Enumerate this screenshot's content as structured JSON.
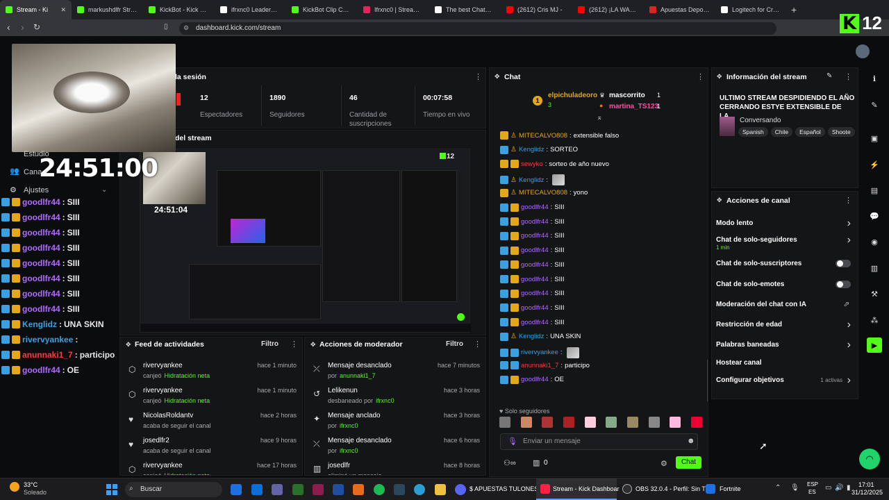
{
  "tabs": [
    {
      "label": "Stream - Ki",
      "color": "#53fc18",
      "active": true
    },
    {
      "label": "markushdlfr Stream",
      "color": "#53fc18"
    },
    {
      "label": "KickBot - Kick Chat",
      "color": "#53fc18"
    },
    {
      "label": "ifrxnc0 LeaderBoar",
      "color": "#ffffff"
    },
    {
      "label": "KickBot Clip Comm",
      "color": "#53fc18"
    },
    {
      "label": "Ifrxnc0 | Streamloot",
      "color": "#e0245e"
    },
    {
      "label": "The best ChatBot ai",
      "color": "#ffffff"
    },
    {
      "label": "(2612) Cris MJ -",
      "color": "#ff0000"
    },
    {
      "label": "(2612) ¡LA WANTED",
      "color": "#ff0000"
    },
    {
      "label": "Apuestas Deportiv",
      "color": "#d22"
    },
    {
      "label": "Logitech for Creato",
      "color": "#fff"
    }
  ],
  "address": "dashboard.kick.com/stream",
  "kick_badge": {
    "letter": "K",
    "viewers": "12"
  },
  "overlay": {
    "timer": "24:51:00",
    "sidebar_items": [
      "Estudio",
      "Cana",
      "Ajustes"
    ],
    "chat": [
      {
        "user": "goodlfr44",
        "msg": "SIII",
        "color": "#b06cff"
      },
      {
        "user": "goodlfr44",
        "msg": "SIII",
        "color": "#b06cff"
      },
      {
        "user": "goodlfr44",
        "msg": "SIII",
        "color": "#b06cff"
      },
      {
        "user": "goodlfr44",
        "msg": "SIII",
        "color": "#b06cff"
      },
      {
        "user": "goodlfr44",
        "msg": "SIII",
        "color": "#b06cff"
      },
      {
        "user": "goodlfr44",
        "msg": "SIII",
        "color": "#b06cff"
      },
      {
        "user": "goodlfr44",
        "msg": "SIII",
        "color": "#b06cff"
      },
      {
        "user": "goodlfr44",
        "msg": "SIII",
        "color": "#b06cff"
      },
      {
        "user": "Kenglidz",
        "msg": "UNA SKIN",
        "color": "#3aa0e0"
      },
      {
        "user": "rivervyankee",
        "msg": "",
        "color": "#3aa0e0"
      },
      {
        "user": "anunnaki1_7",
        "msg": "participo",
        "color": "#ff3a3a"
      },
      {
        "user": "goodlfr44",
        "msg": "OE",
        "color": "#b06cff"
      }
    ]
  },
  "session": {
    "title": "la sesión",
    "stats": [
      {
        "value": "12",
        "label": "Espectadores"
      },
      {
        "value": "1890",
        "label": "Seguidores"
      },
      {
        "value": "46",
        "label": "Cantidad de suscripciones"
      },
      {
        "value": "00:07:58",
        "label": "Tiempo en vivo"
      }
    ]
  },
  "preview": {
    "title": "del stream",
    "mini_timer": "24:51:04",
    "mini_count": "12"
  },
  "activity": {
    "title": "Feed de actividades",
    "filter": "Filtro",
    "items": [
      {
        "user": "rivervyankee",
        "time": "hace 1 minuto",
        "action": "canjeó",
        "detail": "Hidratación neta"
      },
      {
        "user": "rivervyankee",
        "time": "hace 1 minuto",
        "action": "canjeó",
        "detail": "Hidratación neta"
      },
      {
        "user": "NicolasRoldantv",
        "time": "hace 2 horas",
        "action": "acaba de seguir el canal",
        "detail": ""
      },
      {
        "user": "josedlfr2",
        "time": "hace 9 horas",
        "action": "acaba de seguir el canal",
        "detail": ""
      },
      {
        "user": "rivervyankee",
        "time": "hace 17 horas",
        "action": "canjeó",
        "detail": "Hidratación neta"
      }
    ]
  },
  "modactions": {
    "title": "Acciones de moderador",
    "filter": "Filtro",
    "items": [
      {
        "title": "Mensaje desanclado",
        "time": "hace 7 minutos",
        "by": "por",
        "who": "anunnaki1_7"
      },
      {
        "title": "Lelikenun",
        "time": "hace 3 horas",
        "by": "desbaneado por",
        "who": "ifrxnc0"
      },
      {
        "title": "Mensaje anclado",
        "time": "hace 3 horas",
        "by": "por",
        "who": "ifrxnc0"
      },
      {
        "title": "Mensaje desanclado",
        "time": "hace 6 horas",
        "by": "por",
        "who": "ifrxnc0"
      },
      {
        "title": "josedlfr",
        "time": "hace 8 horas",
        "by": "eliminó un mensaje",
        "who": ""
      }
    ]
  },
  "chat": {
    "title": "Chat",
    "pinned": {
      "rank": "1",
      "name1": "elpichuladeoro",
      "count1": "3",
      "name2": "mascorrito",
      "count2": "1",
      "name3": "martina_TS123",
      "count3": "1"
    },
    "messages": [
      {
        "user": "MITECALVO808",
        "msg": "extensible falso",
        "color": "#e2a71a",
        "badges": [
          "gold",
          "none"
        ]
      },
      {
        "user": "Kenglidz",
        "msg": "SORTEO",
        "color": "#3aa0e0",
        "badges": [
          "blue",
          "none"
        ]
      },
      {
        "user": "sewyko",
        "msg": "sorteo de año nuevo",
        "color": "#ff3a3a",
        "badges": [
          "gold",
          "gold"
        ]
      },
      {
        "user": "Kenglidz",
        "msg": "",
        "color": "#3aa0e0",
        "badges": [
          "blue",
          "none"
        ]
      },
      {
        "user": "MITECALVO808",
        "msg": "yono",
        "color": "#e2a71a",
        "badges": [
          "gold",
          "none"
        ]
      },
      {
        "user": "goodlfr44",
        "msg": "SIII",
        "color": "#b06cff",
        "badges": [
          "blue",
          "gold"
        ]
      },
      {
        "user": "goodlfr44",
        "msg": "SIII",
        "color": "#b06cff",
        "badges": [
          "blue",
          "gold"
        ]
      },
      {
        "user": "goodlfr44",
        "msg": "SIII",
        "color": "#b06cff",
        "badges": [
          "blue",
          "gold"
        ]
      },
      {
        "user": "goodlfr44",
        "msg": "SIII",
        "color": "#b06cff",
        "badges": [
          "blue",
          "gold"
        ]
      },
      {
        "user": "goodlfr44",
        "msg": "SIII",
        "color": "#b06cff",
        "badges": [
          "blue",
          "gold"
        ]
      },
      {
        "user": "goodlfr44",
        "msg": "SIII",
        "color": "#b06cff",
        "badges": [
          "blue",
          "gold"
        ]
      },
      {
        "user": "goodlfr44",
        "msg": "SIII",
        "color": "#b06cff",
        "badges": [
          "blue",
          "gold"
        ]
      },
      {
        "user": "goodlfr44",
        "msg": "SIII",
        "color": "#b06cff",
        "badges": [
          "blue",
          "gold"
        ]
      },
      {
        "user": "goodlfr44",
        "msg": "SIII",
        "color": "#b06cff",
        "badges": [
          "blue",
          "gold"
        ]
      },
      {
        "user": "Kenglidz",
        "msg": "UNA SKIN",
        "color": "#3aa0e0",
        "badges": [
          "blue",
          "none"
        ]
      },
      {
        "user": "rivervyankee",
        "msg": "",
        "color": "#3aa0e0",
        "badges": [
          "blue",
          "blue"
        ]
      },
      {
        "user": "anunnaki1_7",
        "msg": "participo",
        "color": "#ff3a3a",
        "badges": [
          "blue",
          "blue"
        ]
      },
      {
        "user": "goodlfr44",
        "msg": "OE",
        "color": "#b06cff",
        "badges": [
          "blue",
          "gold"
        ]
      }
    ],
    "followers_label": "Solo seguidores",
    "input_placeholder": "Enviar un mensaje",
    "points": "0",
    "send_label": "Chat"
  },
  "stream_info": {
    "title": "Información del stream",
    "stream_title": "ULTIMO STREAM DESPIDIENDO EL AÑO CERRANDO ESTYE EXTENSIBLE DE LA...",
    "category": "Conversando",
    "tags": [
      "Spanish",
      "Chile",
      "Español",
      "Shoote"
    ]
  },
  "channel_actions": {
    "title": "Acciones de canal",
    "items": [
      {
        "label": "Modo lento",
        "type": "chevron",
        "sub": ""
      },
      {
        "label": "Chat de solo-seguidores",
        "type": "chevron",
        "sub": "1 min"
      },
      {
        "label": "Chat de solo-suscriptores",
        "type": "toggle",
        "sub": ""
      },
      {
        "label": "Chat de solo-emotes",
        "type": "toggle",
        "sub": ""
      },
      {
        "label": "Moderación del chat con IA",
        "type": "external",
        "sub": ""
      },
      {
        "label": "Restricción de edad",
        "type": "chevron",
        "sub": ""
      },
      {
        "label": "Palabras baneadas",
        "type": "chevron",
        "sub": ""
      },
      {
        "label": "Hostear canal",
        "type": "none",
        "sub": ""
      },
      {
        "label": "Configurar objetivos",
        "type": "chevron",
        "sub": "1 activas"
      }
    ]
  },
  "taskbar": {
    "weather_temp": "33°C",
    "weather_desc": "Soleado",
    "search": "Buscar",
    "apps": [
      "$ APUESTAS TULONES $",
      "Stream - Kick Dashboar",
      "OBS 32.0.4 - Perfil: Sin T",
      "Fortnite"
    ],
    "lang1": "ESP",
    "lang2": "ES",
    "time": "17:01",
    "date": "31/12/2025"
  }
}
